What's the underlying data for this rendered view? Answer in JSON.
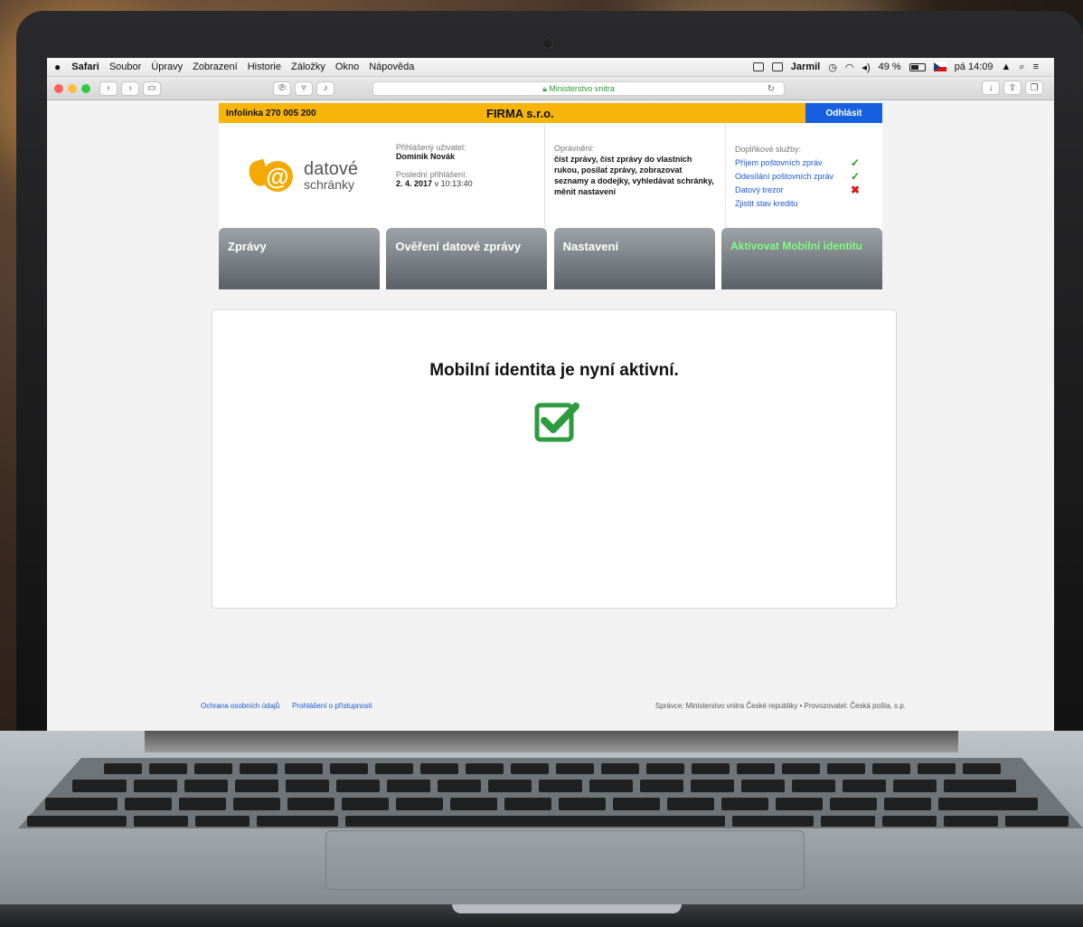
{
  "menubar": {
    "app": "Safari",
    "items": [
      "Soubor",
      "Úpravy",
      "Zobrazení",
      "Historie",
      "Záložky",
      "Okno",
      "Nápověda"
    ],
    "user": "Jarmil",
    "battery": "49 %",
    "clock": "pá 14:09"
  },
  "browser": {
    "address": "Ministerstvo vnitra"
  },
  "topbar": {
    "infoline": "Infolinka 270 005 200",
    "company": "FIRMA s.r.o.",
    "logout": "Odhlásit"
  },
  "logo": {
    "line1": "datové",
    "line2": "schránky"
  },
  "user_info": {
    "user_label": "Přihlášený uživatel:",
    "user_name": "Dominik Novák",
    "last_login_label": "Poslední přihlášení:",
    "last_login_date": "2. 4. 2017",
    "last_login_time": "v 10:13:40"
  },
  "permissions": {
    "label": "Oprávnění:",
    "text": "číst zprávy, číst zprávy do vlastních rukou, posílat zprávy, zobrazovat seznamy a dodejky, vyhledávat schránky, měnit nastavení"
  },
  "services": {
    "label": "Doplňkové služby:",
    "items": [
      {
        "label": "Příjem poštovních zpráv",
        "status": "✓"
      },
      {
        "label": "Odesílání poštovních zpráv",
        "status": "✓"
      },
      {
        "label": "Datový trezor",
        "status": "✖"
      }
    ],
    "credit_link": "Zjistit stav kreditu"
  },
  "tabs": [
    {
      "label": "Zprávy"
    },
    {
      "label": "Ověření datové zprávy"
    },
    {
      "label": "Nastavení"
    },
    {
      "label": "Aktivovat Mobilní identitu"
    }
  ],
  "content": {
    "message": "Mobilní identita je nyní aktivní."
  },
  "footer": {
    "privacy": "Ochrana osobních údajů",
    "accessibility": "Prohlášení o přístupnosti",
    "operator": "Správce: Ministerstvo vnitra České republiky • Provozovatel: Česká pošta, s.p."
  },
  "colors": {
    "topbar": "#f7b40a",
    "logout": "#1660e0",
    "active_tab_text": "#7dff7d",
    "check": "#2e9b3e"
  }
}
